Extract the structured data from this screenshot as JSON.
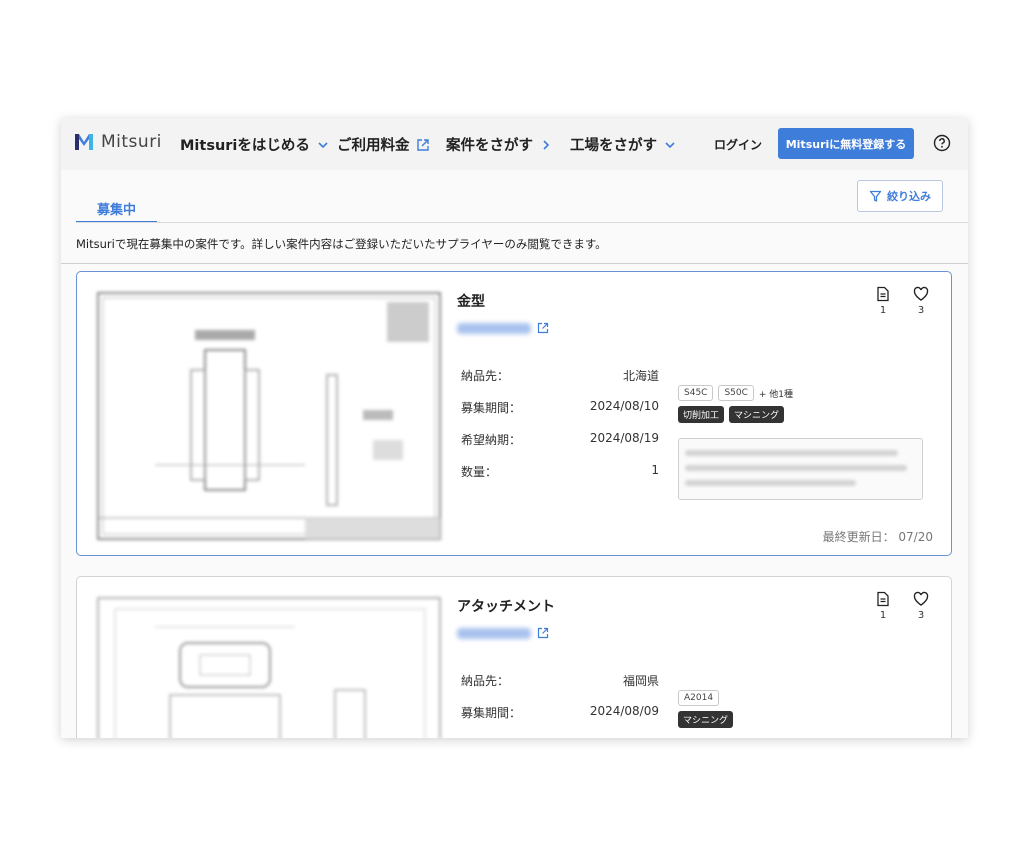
{
  "header": {
    "logo_text": "Mitsuri",
    "nav": {
      "start": "Mitsuriをはじめる",
      "pricing": "ご利用料金",
      "find_projects": "案件をさがす",
      "find_factories": "工場をさがす"
    },
    "login": "ログイン",
    "signup": "Mitsuriに無料登録する"
  },
  "tabs": {
    "active": "募集中"
  },
  "filter_label": "絞り込み",
  "description": "Mitsuriで現在募集中の案件です。詳しい案件内容はご登録いただいたサプライヤーのみ閲覧できます。",
  "colors": {
    "accent": "#3f7ddb",
    "dark_tag": "#333333"
  },
  "cards": [
    {
      "title": "金型",
      "labels": {
        "delivery": "納品先：",
        "period": "募集期間：",
        "due": "希望納期：",
        "qty": "数量："
      },
      "delivery": "北海道",
      "period": "2024/08/10",
      "due": "2024/08/19",
      "qty": "1",
      "materials": [
        "S45C",
        "S50C"
      ],
      "more": "+ 他1種",
      "processes": [
        "切削加工",
        "マシニング"
      ],
      "files": "1",
      "likes": "3",
      "updated": "最終更新日：  07/20"
    },
    {
      "title": "アタッチメント",
      "labels": {
        "delivery": "納品先：",
        "period": "募集期間："
      },
      "delivery": "福岡県",
      "period": "2024/08/09",
      "materials": [
        "A2014"
      ],
      "processes": [
        "マシニング"
      ],
      "files": "1",
      "likes": "3"
    }
  ]
}
